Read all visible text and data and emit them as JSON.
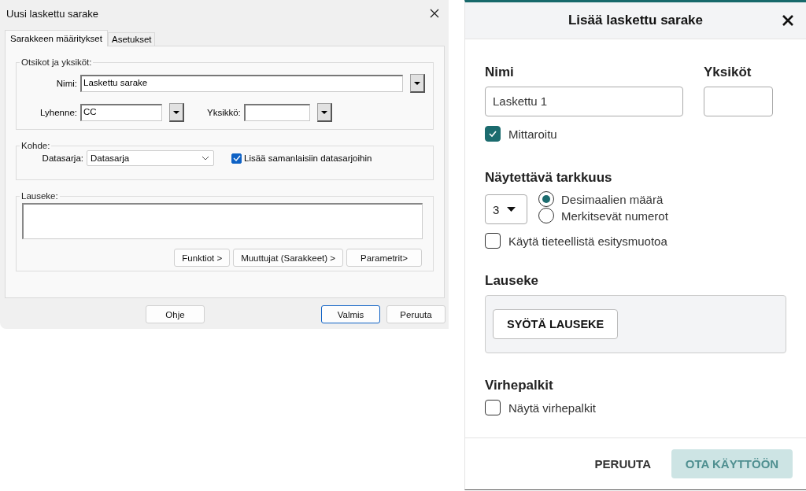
{
  "classic_dialog": {
    "title": "Uusi laskettu sarake",
    "tabs": [
      {
        "label": "Sarakkeen määritykset",
        "selected": true
      },
      {
        "label": "Asetukset",
        "selected": false
      }
    ],
    "titles_group": {
      "legend": "Otsikot ja yksiköt:",
      "name": {
        "label": "Nimi:",
        "value": "Laskettu sarake"
      },
      "abbreviation": {
        "label": "Lyhenne:",
        "value": "CC"
      },
      "unit": {
        "label": "Yksikkö:"
      }
    },
    "target_group": {
      "legend": "Kohde:",
      "dataset": {
        "label": "Datasarja:",
        "value": "Datasarja"
      },
      "add_to_similar": {
        "label": "Lisää samanlaisiin datasarjoihin",
        "checked": true
      }
    },
    "expression_group": {
      "legend": "Lauseke:",
      "buttons": [
        "Funktiot >",
        "Muuttujat (Sarakkeet) >",
        "Parametrit>"
      ]
    },
    "buttons": [
      {
        "label": "Ohje",
        "default": false
      },
      {
        "label": "Valmis",
        "default": true
      },
      {
        "label": "Peruuta",
        "default": false
      }
    ]
  },
  "modern_dialog": {
    "title": "Lisää laskettu sarake",
    "name": {
      "label": "Nimi",
      "value": "Laskettu 1"
    },
    "units": {
      "label": "Yksiköt"
    },
    "metered": {
      "label": "Mittaroitu",
      "checked": true
    },
    "precision": {
      "heading": "Näytettävä tarkkuus",
      "digits": "3",
      "modes": [
        {
          "label": "Desimaalien määrä",
          "selected": true
        },
        {
          "label": "Merkitsevät numerot",
          "selected": false
        }
      ],
      "scientific": {
        "label": "Käytä tieteellistä esitysmuotoa",
        "checked": false
      }
    },
    "expression": {
      "heading": "Lauseke",
      "button": "SYÖTÄ LAUSEKE"
    },
    "error_bars": {
      "heading": "Virhepalkit",
      "show": {
        "label": "Näytä virhepalkit",
        "checked": false
      }
    },
    "footer": {
      "cancel": "PERUUTA",
      "apply": {
        "label": "OTA KÄYTTÖÖN",
        "disabled": true
      }
    }
  }
}
